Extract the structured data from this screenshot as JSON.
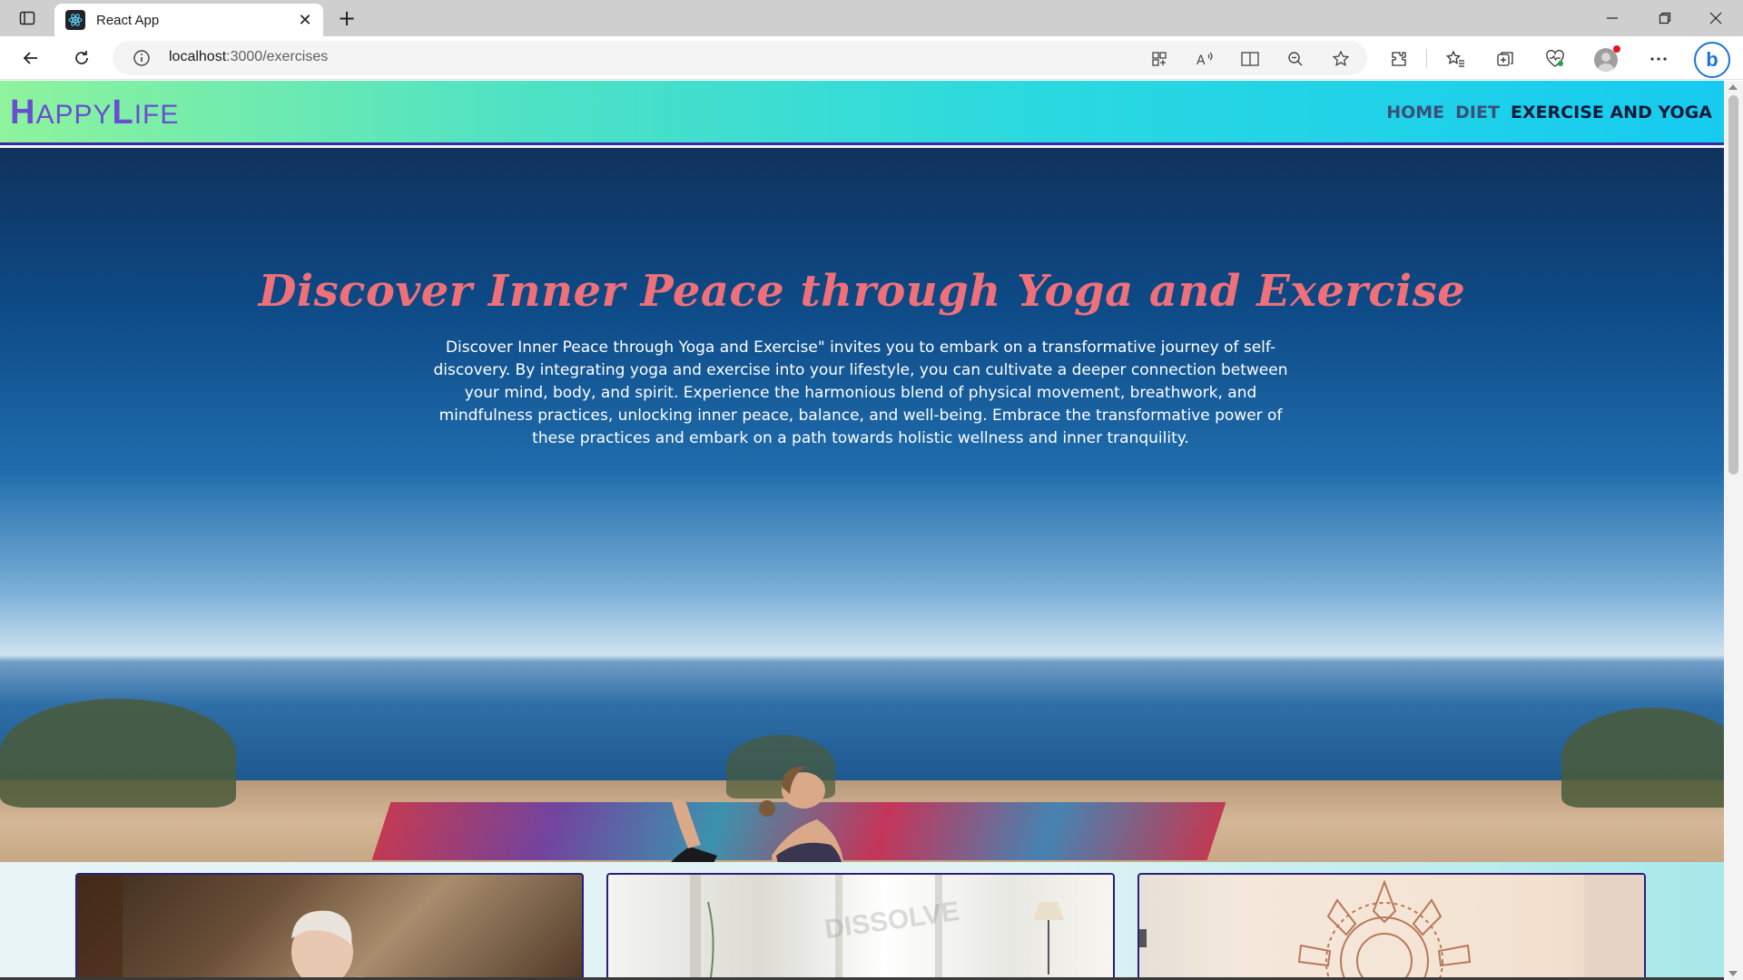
{
  "browser": {
    "tab_title": "React App",
    "tab_close": "✕",
    "new_tab": "+",
    "url_host": "localhost",
    "url_path": ":3000/exercises",
    "window_controls": [
      "minimize",
      "restore",
      "close"
    ],
    "profile_notification": true
  },
  "site": {
    "logo_letter_1": "H",
    "logo_rest_1": "APPY",
    "logo_letter_2": "L",
    "logo_rest_2": "IFE",
    "nav": [
      {
        "label": "HOME",
        "active": false
      },
      {
        "label": "DIET",
        "active": false
      },
      {
        "label": "EXERCISE AND YOGA",
        "active": true
      }
    ]
  },
  "hero": {
    "title": "Discover Inner Peace through Yoga and Exercise",
    "text": "Discover Inner Peace through Yoga and Exercise\" invites you to embark on a transformative journey of self-discovery. By integrating yoga and exercise into your lifestyle, you can cultivate a deeper connection between your mind, body, and spirit. Experience the harmonious blend of physical movement, breathwork, and mindfulness practices, unlocking inner peace, balance, and well-being. Embrace the transformative power of these practices and embark on a path towards holistic wellness and inner tranquility."
  },
  "cards": [
    {
      "image": "older-woman-yoga-photo"
    },
    {
      "image": "bright-room-yoga-photo",
      "watermark": "DISSOLVE"
    },
    {
      "image": "mandala-wall-photo"
    }
  ],
  "colors": {
    "navbar_gradient_start": "#8ef39c",
    "navbar_gradient_end": "#17cbf0",
    "logo": "#6a4ed2",
    "hero_title": "#f0707a",
    "card_border": "#2c1f7a"
  }
}
